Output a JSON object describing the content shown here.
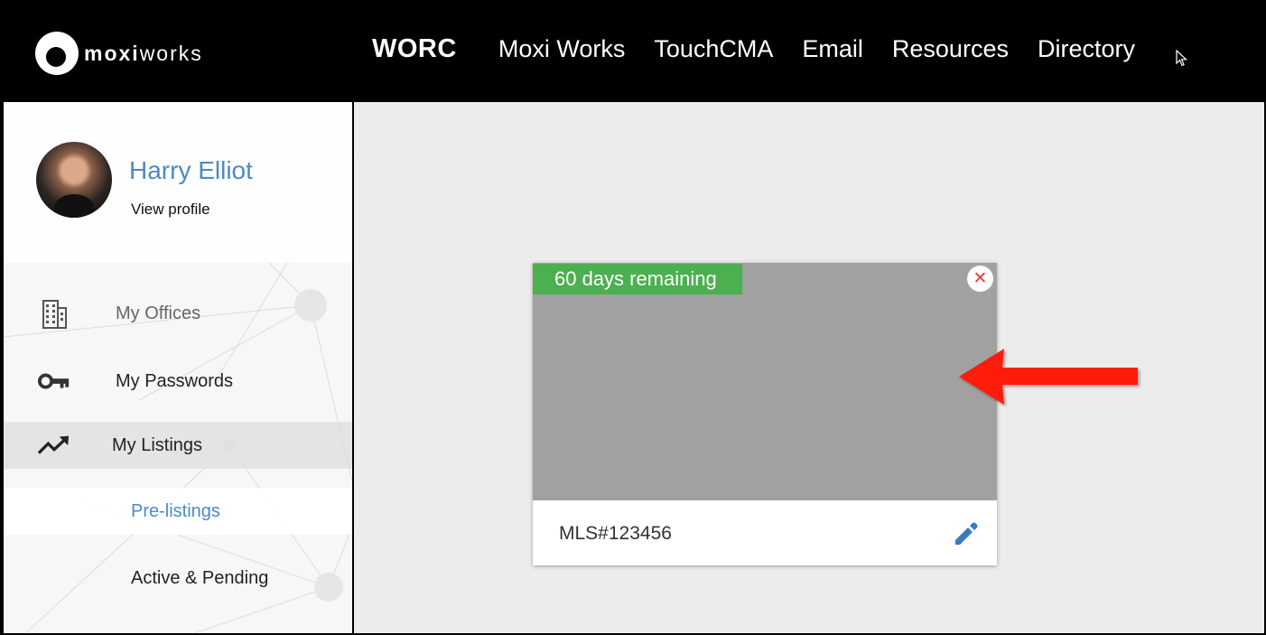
{
  "brand": {
    "logo_text_bold": "moxi",
    "logo_text_light": "works"
  },
  "nav": {
    "items": [
      {
        "label": "WORC"
      },
      {
        "label": "Moxi Works"
      },
      {
        "label": "TouchCMA"
      },
      {
        "label": "Email"
      },
      {
        "label": "Resources"
      },
      {
        "label": "Directory"
      }
    ]
  },
  "profile": {
    "name": "Harry Elliot",
    "link": "View profile"
  },
  "sidebar": {
    "items": [
      {
        "label": "My Offices",
        "icon": "building-icon"
      },
      {
        "label": "My Passwords",
        "icon": "key-icon"
      },
      {
        "label": "My Listings",
        "icon": "trending-up-icon"
      },
      {
        "label": "Pre-listings"
      },
      {
        "label": "Active & Pending"
      }
    ]
  },
  "listing_card": {
    "badge": "60 days remaining",
    "close_glyph": "✕",
    "mls": "MLS#123456"
  },
  "colors": {
    "accent_blue": "#4a8ac8",
    "badge_green": "#4caf50",
    "close_red": "#e53935",
    "arrow_red": "#ff1a0a"
  }
}
